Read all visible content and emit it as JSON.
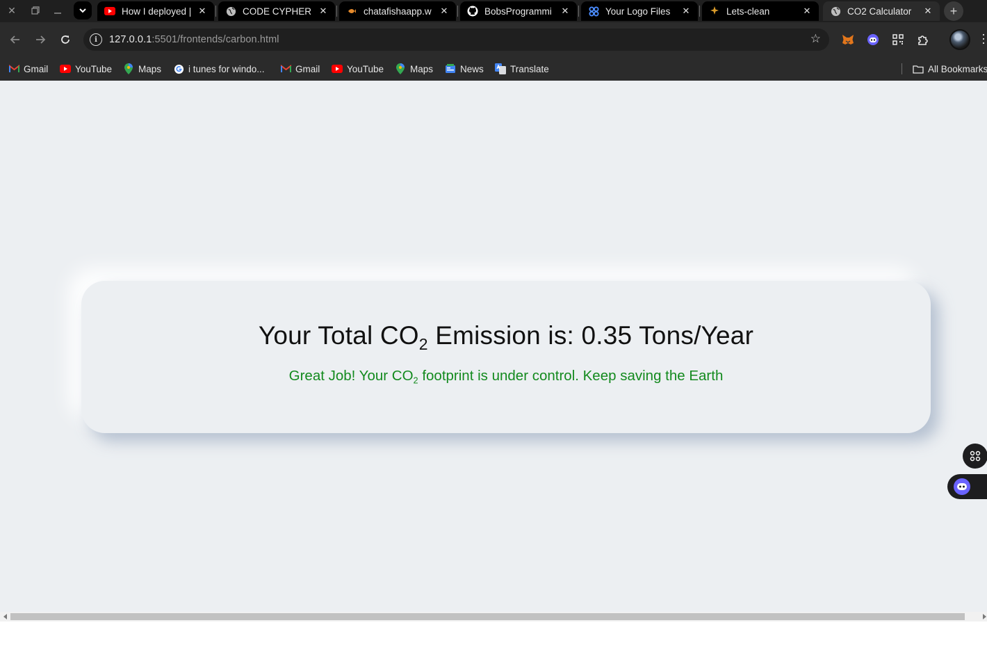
{
  "browser": {
    "tabs": [
      {
        "title": "How I deployed |",
        "favicon": "youtube-icon",
        "active": false
      },
      {
        "title": "CODE CYPHER",
        "favicon": "globe-icon",
        "active": false
      },
      {
        "title": "chatafishaapp.w",
        "favicon": "fish-icon",
        "active": false
      },
      {
        "title": "BobsProgrammi",
        "favicon": "github-icon",
        "active": false
      },
      {
        "title": "Your Logo Files",
        "favicon": "logo-icon",
        "active": false
      },
      {
        "title": "Lets-clean",
        "favicon": "sparkle-icon",
        "active": false
      },
      {
        "title": "CO2 Calculator",
        "favicon": "globe-icon",
        "active": true
      }
    ],
    "url_host": "127.0.0.1",
    "url_rest": ":5501/frontends/carbon.html",
    "bookmarks": [
      {
        "label": "Gmail",
        "icon": "gmail-icon"
      },
      {
        "label": "YouTube",
        "icon": "youtube-icon"
      },
      {
        "label": "Maps",
        "icon": "maps-icon"
      },
      {
        "label": "i tunes for windo...",
        "icon": "google-icon"
      },
      {
        "label": "Gmail",
        "icon": "gmail-icon"
      },
      {
        "label": "YouTube",
        "icon": "youtube-icon"
      },
      {
        "label": "Maps",
        "icon": "maps-icon"
      },
      {
        "label": "News",
        "icon": "news-icon"
      },
      {
        "label": "Translate",
        "icon": "translate-icon"
      }
    ],
    "all_bookmarks_label": "All Bookmarks"
  },
  "page": {
    "title_prefix": "Your Total CO",
    "title_sub": "2",
    "title_suffix": " Emission is: 0.35 Tons/Year",
    "message_prefix": "Great Job! Your CO",
    "message_sub": "2",
    "message_suffix": " footprint is under control. Keep saving the Earth",
    "message_color": "#138a1e"
  }
}
